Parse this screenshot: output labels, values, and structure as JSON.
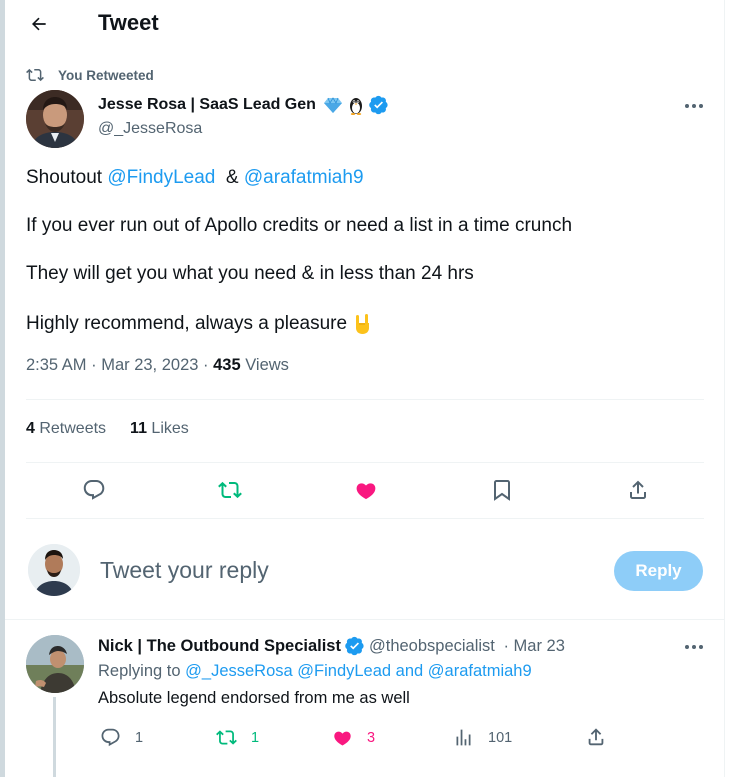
{
  "header": {
    "title": "Tweet"
  },
  "retweet_banner": {
    "text": "You Retweeted"
  },
  "tweet": {
    "author_name": "Jesse Rosa | SaaS Lead Gen",
    "author_handle": "@_JesseRosa",
    "line1": {
      "prefix": "Shoutout ",
      "mention1": "@FindyLead",
      "middle": "  & ",
      "mention2": "@arafatmiah9"
    },
    "line2": "If you ever run out of Apollo credits or need a list in a time crunch",
    "line3": "They will get you what you need & in less than 24 hrs",
    "line4": "Highly recommend, always a pleasure",
    "time": "2:35 AM · Mar 23, 2023 · ",
    "views_count": "435",
    "views_label": " Views",
    "retweets_count": "4",
    "retweets_label": " Retweets",
    "likes_count": "11",
    "likes_label": " Likes"
  },
  "reply_composer": {
    "placeholder": "Tweet your reply",
    "button_label": "Reply"
  },
  "reply": {
    "author_name": "Nick | The Outbound Specialist",
    "author_handle": "@theobspecialist",
    "date": " · Mar 23",
    "replying_prefix": "Replying to ",
    "replying_users": "@_JesseRosa @FindyLead and @arafatmiah9",
    "text": "Absolute legend endorsed from me as well",
    "reply_count": "1",
    "retweet_count": "1",
    "like_count": "3",
    "view_count": "101"
  },
  "colors": {
    "accent": "#1d9bf0",
    "retweet_green": "#00ba7c",
    "like_pink": "#f91880",
    "muted": "#536471",
    "reply_button": "#8ecdf8"
  },
  "icons": [
    "back-arrow-icon",
    "retweet-icon",
    "gem-icon",
    "penguin-icon",
    "verified-badge-icon",
    "more-options-icon",
    "reply-icon",
    "like-icon",
    "bookmark-icon",
    "share-icon",
    "views-icon",
    "rock-on-hand-icon"
  ]
}
